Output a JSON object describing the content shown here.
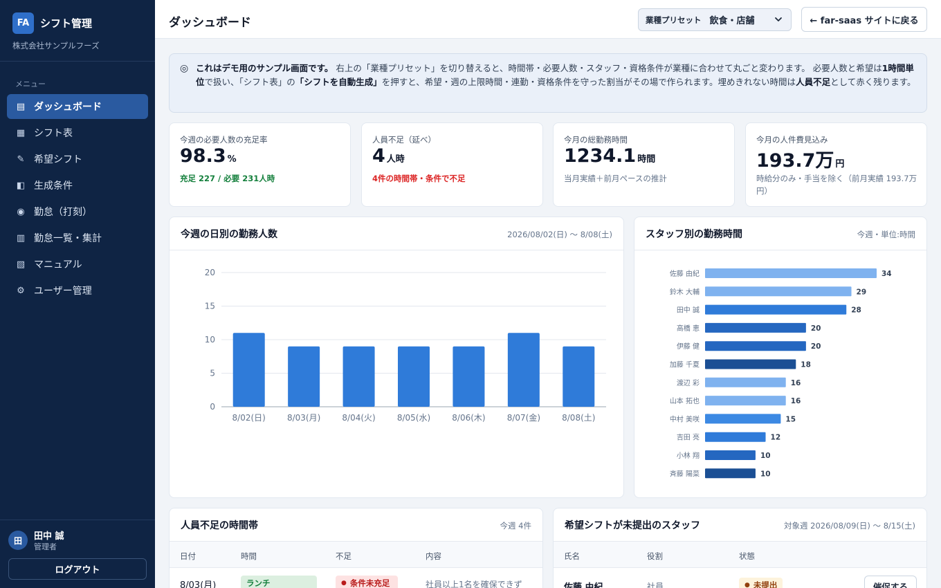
{
  "sidebar": {
    "brand_badge": "FA",
    "brand_title": "シフト管理",
    "company": "株式会社サンプルフーズ",
    "menu_label": "メニュー",
    "items": [
      {
        "label": "ダッシュボード",
        "icon": "dashboard-icon",
        "active": true
      },
      {
        "label": "シフト表",
        "icon": "grid-icon"
      },
      {
        "label": "希望シフト",
        "icon": "pencil-icon"
      },
      {
        "label": "生成条件",
        "icon": "half-square-icon"
      },
      {
        "label": "勤怠（打刻）",
        "icon": "clock-dot-icon"
      },
      {
        "label": "勤怠一覧・集計",
        "icon": "table-icon"
      },
      {
        "label": "マニュアル",
        "icon": "book-icon"
      },
      {
        "label": "ユーザー管理",
        "icon": "gear-icon"
      }
    ],
    "user": {
      "avatar": "田",
      "name": "田中 誠",
      "role": "管理者"
    },
    "logout_label": "ログアウト"
  },
  "header": {
    "title": "ダッシュボード",
    "preset_label": "業種プリセット",
    "preset_value": "飲食・店舗",
    "back_label": "← far-saas サイトに戻る"
  },
  "notice": {
    "icon": "◎",
    "bold1": "これはデモ用のサンプル画面です。",
    "t1": " 右上の「業種プリセット」を切り替えると、時間帯・必要人数・スタッフ・資格条件が業種に合わせて丸ごと変わります。 必要人数と希望は",
    "bold2": "1時間単位",
    "t2": "で扱い、「シフト表」の",
    "bold3": "「シフトを自動生成」",
    "t3": "を押すと、希望・週の上限時間・連勤・資格条件を守った割当がその場で作られます。埋めきれない時間は",
    "bold4": "人員不足",
    "t4": "として赤く残ります。"
  },
  "kpis": [
    {
      "label": "今週の必要人数の充足率",
      "value": "98.3",
      "unit": "%",
      "sub": "充足 227 / 必要 231人時",
      "sub_style": "green"
    },
    {
      "label": "人員不足（延べ）",
      "value": "4",
      "unit": "人時",
      "sub": "4件の時間帯・条件で不足",
      "sub_style": "red"
    },
    {
      "label": "今月の総勤務時間",
      "value": "1234.1",
      "unit": "時間",
      "sub": "当月実績＋前月ペースの推計",
      "sub_style": "gray"
    },
    {
      "label": "今月の人件費見込み",
      "value": "193.7万",
      "unit": "円",
      "sub": "時給分のみ・手当を除く（前月実績 193.7万円）",
      "sub_style": "gray"
    }
  ],
  "daily_panel": {
    "title": "今週の日別の勤務人数",
    "meta": "2026/08/02(日) 〜 8/08(土)"
  },
  "staff_panel": {
    "title": "スタッフ別の勤務時間",
    "meta": "今週・単位:時間"
  },
  "chart_data": [
    {
      "type": "bar",
      "title": "今週の日別の勤務人数",
      "categories": [
        "8/02(日)",
        "8/03(月)",
        "8/04(火)",
        "8/05(水)",
        "8/06(木)",
        "8/07(金)",
        "8/08(土)"
      ],
      "values": [
        11,
        9,
        9,
        9,
        9,
        11,
        9
      ],
      "ylim": [
        0,
        20
      ],
      "yticks": [
        0,
        5,
        10,
        15,
        20
      ],
      "grid": true,
      "color": "#2f7bd9"
    },
    {
      "type": "bar",
      "orientation": "horizontal",
      "title": "スタッフ別の勤務時間",
      "categories": [
        "佐藤 由紀",
        "鈴木 大輔",
        "田中 誠",
        "高橋 恵",
        "伊藤 健",
        "加藤 千夏",
        "渡辺 彩",
        "山本 拓也",
        "中村 美咲",
        "吉田 亮",
        "小林 翔",
        "斉藤 陽菜"
      ],
      "values": [
        34,
        29,
        28,
        20,
        20,
        18,
        16,
        16,
        15,
        12,
        10,
        10
      ],
      "colors": [
        "#7fb2ef",
        "#7fb2ef",
        "#2f7bd9",
        "#2567c0",
        "#2567c0",
        "#1b4f94",
        "#7fb2ef",
        "#7fb2ef",
        "#3c89e3",
        "#2f7bd9",
        "#2567c0",
        "#1b4f94"
      ]
    }
  ],
  "shortage": {
    "title": "人員不足の時間帯",
    "meta": "今週 4件",
    "columns": [
      "日付",
      "時間",
      "不足",
      "内容"
    ],
    "rows": [
      {
        "date": "8/03(月)",
        "time": "ランチ",
        "shortage": "条件未充足",
        "detail": "社員以上1名を確保できず"
      }
    ]
  },
  "unsubmitted": {
    "title": "希望シフトが未提出のスタッフ",
    "meta": "対象週 2026/08/09(日) 〜 8/15(土)",
    "columns": [
      "氏名",
      "役割",
      "状態"
    ],
    "rows": [
      {
        "name": "佐藤 由紀",
        "role": "社員",
        "status": "未提出",
        "action": "催促する"
      }
    ]
  }
}
